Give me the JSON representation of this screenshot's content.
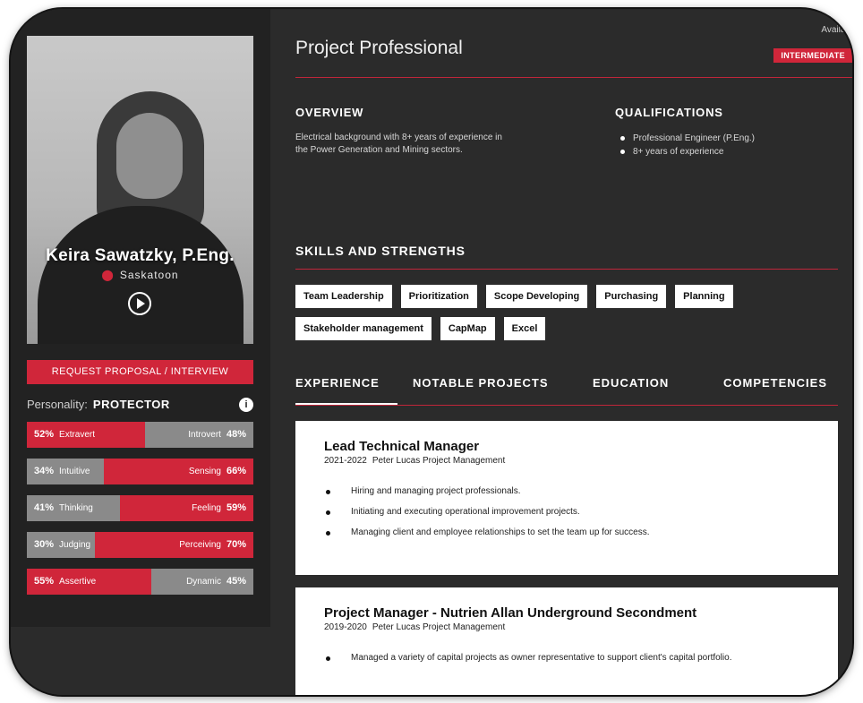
{
  "profile": {
    "name": "Keira Sawatzky, P.Eng.",
    "location": "Saskatoon",
    "request_button": "REQUEST PROPOSAL / INTERVIEW",
    "personality_label": "Personality:",
    "personality_type": "PROTECTOR",
    "traits": [
      {
        "left_pct": "52%",
        "left_label": "Extravert",
        "right_label": "Introvert",
        "right_pct": "48%",
        "left_value": 52
      },
      {
        "left_pct": "34%",
        "left_label": "Intuitive",
        "right_label": "Sensing",
        "right_pct": "66%",
        "left_value": 34
      },
      {
        "left_pct": "41%",
        "left_label": "Thinking",
        "right_label": "Feeling",
        "right_pct": "59%",
        "left_value": 41
      },
      {
        "left_pct": "30%",
        "left_label": "Judging",
        "right_label": "Perceiving",
        "right_pct": "70%",
        "left_value": 30
      },
      {
        "left_pct": "55%",
        "left_label": "Assertive",
        "right_label": "Dynamic",
        "right_pct": "45%",
        "left_value": 55
      }
    ]
  },
  "header": {
    "title": "Project Professional",
    "availability": "Availab",
    "level": "INTERMEDIATE"
  },
  "overview": {
    "heading": "OVERVIEW",
    "text": "Electrical background with 8+ years of experience in the Power Generation and Mining sectors."
  },
  "qualifications": {
    "heading": "QUALIFICATIONS",
    "items": [
      "Professional Engineer (P.Eng.)",
      "8+ years of experience"
    ]
  },
  "skills": {
    "heading": "SKILLS AND STRENGTHS",
    "items": [
      "Team Leadership",
      "Prioritization",
      "Scope Developing",
      "Purchasing",
      "Planning",
      "Stakeholder management",
      "CapMap",
      "Excel"
    ]
  },
  "tabs": [
    "EXPERIENCE",
    "NOTABLE PROJECTS",
    "EDUCATION",
    "COMPETENCIES"
  ],
  "experience": [
    {
      "role": "Lead Technical Manager",
      "years": "2021-2022",
      "company": "Peter Lucas Project Management",
      "bullets": [
        "Hiring and managing project professionals.",
        "Initiating and executing operational improvement projects.",
        "Managing client and employee relationships to set the team up for success."
      ]
    },
    {
      "role": "Project Manager - Nutrien Allan Underground Secondment",
      "years": "2019-2020",
      "company": "Peter Lucas Project Management",
      "bullets": [
        "Managed a variety of capital projects as owner representative to support client's capital portfolio."
      ]
    }
  ],
  "colors": {
    "accent": "#d0263a",
    "background": "#2b2b2b",
    "panel": "#222222",
    "card": "#ffffff"
  }
}
